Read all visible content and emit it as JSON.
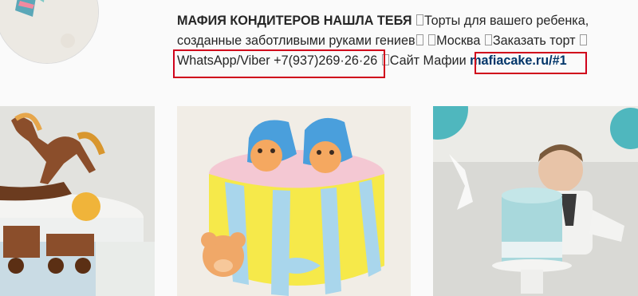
{
  "profile": {
    "name": "МАФИЯ КОНДИТЕРОВ НАШЛА ТЕБЯ",
    "bio_1": "Торты для вашего ребенка,",
    "bio_2a": "созданные заботливыми руками гениев",
    "bio_2b": "Москва",
    "bio_2c": "Заказать торт",
    "phone": "WhatsApp/Viber +7(937)269·26·26",
    "site_label": "Сайт Мафии",
    "site_link": "mafiacake.ru/#1"
  },
  "colors": {
    "highlight": "#d0021b",
    "link": "#003569",
    "background": "#fafafa"
  },
  "posts": [
    {
      "subject": "rocking-horse-train-cake"
    },
    {
      "subject": "baby-shoes-bear-cake"
    },
    {
      "subject": "baby-smash-cake"
    }
  ]
}
